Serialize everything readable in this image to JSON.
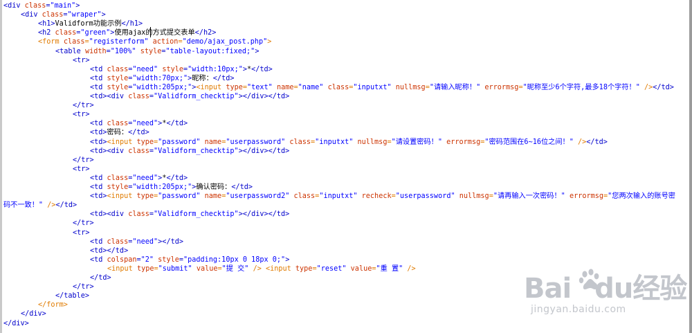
{
  "code_lines": [
    {
      "indent": 0,
      "tokens": [
        {
          "c": "tag",
          "t": "<div "
        },
        {
          "c": "at",
          "t": "class"
        },
        {
          "c": "tag",
          "t": "="
        },
        {
          "c": "val",
          "t": "\"main\""
        },
        {
          "c": "tag",
          "t": ">"
        }
      ]
    },
    {
      "indent": 1,
      "tokens": [
        {
          "c": "tag",
          "t": "<div "
        },
        {
          "c": "at",
          "t": "class"
        },
        {
          "c": "tag",
          "t": "="
        },
        {
          "c": "val",
          "t": "\"wraper\""
        },
        {
          "c": "tag",
          "t": ">"
        }
      ]
    },
    {
      "indent": 2,
      "tokens": [
        {
          "c": "tag",
          "t": "<h1>"
        },
        {
          "c": "txt",
          "t": "Validform功能示例"
        },
        {
          "c": "tag",
          "t": "</h1>"
        }
      ]
    },
    {
      "indent": 2,
      "tokens": [
        {
          "c": "tag",
          "t": "<h2 "
        },
        {
          "c": "at",
          "t": "class"
        },
        {
          "c": "tag",
          "t": "="
        },
        {
          "c": "val",
          "t": "\"green\""
        },
        {
          "c": "tag",
          "t": ">"
        },
        {
          "c": "txt",
          "t": "使用ajax的方式提交表单"
        },
        {
          "c": "tag",
          "t": "</h2>"
        }
      ]
    },
    {
      "indent": 2,
      "tokens": [
        {
          "c": "form",
          "t": "<form "
        },
        {
          "c": "at",
          "t": "class"
        },
        {
          "c": "form",
          "t": "="
        },
        {
          "c": "val",
          "t": "\"registerform\""
        },
        {
          "c": "form",
          "t": " "
        },
        {
          "c": "at",
          "t": "action"
        },
        {
          "c": "form",
          "t": "="
        },
        {
          "c": "val",
          "t": "\"demo/ajax_post.php\""
        },
        {
          "c": "form",
          "t": ">"
        }
      ]
    },
    {
      "indent": 3,
      "tokens": [
        {
          "c": "tag",
          "t": "<table "
        },
        {
          "c": "at",
          "t": "width"
        },
        {
          "c": "tag",
          "t": "="
        },
        {
          "c": "val",
          "t": "\"100%\""
        },
        {
          "c": "tag",
          "t": " "
        },
        {
          "c": "at",
          "t": "style"
        },
        {
          "c": "tag",
          "t": "="
        },
        {
          "c": "val",
          "t": "\"table-layout:fixed;\""
        },
        {
          "c": "tag",
          "t": ">"
        }
      ]
    },
    {
      "indent": 4,
      "tokens": [
        {
          "c": "tag",
          "t": "<tr>"
        }
      ]
    },
    {
      "indent": 5,
      "tokens": [
        {
          "c": "tag",
          "t": "<td "
        },
        {
          "c": "at",
          "t": "class"
        },
        {
          "c": "tag",
          "t": "="
        },
        {
          "c": "val",
          "t": "\"need\""
        },
        {
          "c": "tag",
          "t": " "
        },
        {
          "c": "at",
          "t": "style"
        },
        {
          "c": "tag",
          "t": "="
        },
        {
          "c": "val",
          "t": "\"width:10px;\""
        },
        {
          "c": "tag",
          "t": ">"
        },
        {
          "c": "txt",
          "t": "*"
        },
        {
          "c": "tag",
          "t": "</td>"
        }
      ]
    },
    {
      "indent": 5,
      "tokens": [
        {
          "c": "tag",
          "t": "<td "
        },
        {
          "c": "at",
          "t": "style"
        },
        {
          "c": "tag",
          "t": "="
        },
        {
          "c": "val",
          "t": "\"width:70px;\""
        },
        {
          "c": "tag",
          "t": ">"
        },
        {
          "c": "txt",
          "t": "昵称："
        },
        {
          "c": "tag",
          "t": "</td>"
        }
      ]
    },
    {
      "indent": 5,
      "tokens": [
        {
          "c": "tag",
          "t": "<td "
        },
        {
          "c": "at",
          "t": "style"
        },
        {
          "c": "tag",
          "t": "="
        },
        {
          "c": "val",
          "t": "\"width:205px;\""
        },
        {
          "c": "tag",
          "t": ">"
        },
        {
          "c": "form",
          "t": "<input "
        },
        {
          "c": "at",
          "t": "type"
        },
        {
          "c": "form",
          "t": "="
        },
        {
          "c": "val",
          "t": "\"text\""
        },
        {
          "c": "form",
          "t": " "
        },
        {
          "c": "at",
          "t": "name"
        },
        {
          "c": "form",
          "t": "="
        },
        {
          "c": "val",
          "t": "\"name\""
        },
        {
          "c": "form",
          "t": " "
        },
        {
          "c": "at",
          "t": "class"
        },
        {
          "c": "form",
          "t": "="
        },
        {
          "c": "val",
          "t": "\"inputxt\""
        },
        {
          "c": "form",
          "t": " "
        },
        {
          "c": "at",
          "t": "nullmsg"
        },
        {
          "c": "form",
          "t": "="
        },
        {
          "c": "val",
          "t": "\"请输入昵称！\""
        },
        {
          "c": "form",
          "t": " "
        },
        {
          "c": "at",
          "t": "errormsg"
        },
        {
          "c": "form",
          "t": "="
        },
        {
          "c": "val",
          "t": "\"昵称至少6个字符,最多18个字符！\""
        },
        {
          "c": "form",
          "t": " />"
        },
        {
          "c": "tag",
          "t": "</td>"
        }
      ]
    },
    {
      "indent": 5,
      "tokens": [
        {
          "c": "tag",
          "t": "<td><div "
        },
        {
          "c": "at",
          "t": "class"
        },
        {
          "c": "tag",
          "t": "="
        },
        {
          "c": "val",
          "t": "\"Validform_checktip\""
        },
        {
          "c": "tag",
          "t": "></div></td>"
        }
      ]
    },
    {
      "indent": 4,
      "tokens": [
        {
          "c": "tag",
          "t": "</tr>"
        }
      ]
    },
    {
      "indent": 4,
      "tokens": [
        {
          "c": "tag",
          "t": "<tr>"
        }
      ]
    },
    {
      "indent": 5,
      "tokens": [
        {
          "c": "tag",
          "t": "<td "
        },
        {
          "c": "at",
          "t": "class"
        },
        {
          "c": "tag",
          "t": "="
        },
        {
          "c": "val",
          "t": "\"need\""
        },
        {
          "c": "tag",
          "t": ">"
        },
        {
          "c": "txt",
          "t": "*"
        },
        {
          "c": "tag",
          "t": "</td>"
        }
      ]
    },
    {
      "indent": 5,
      "tokens": [
        {
          "c": "tag",
          "t": "<td>"
        },
        {
          "c": "txt",
          "t": "密码："
        },
        {
          "c": "tag",
          "t": "</td>"
        }
      ]
    },
    {
      "indent": 5,
      "tokens": [
        {
          "c": "tag",
          "t": "<td>"
        },
        {
          "c": "form",
          "t": "<input "
        },
        {
          "c": "at",
          "t": "type"
        },
        {
          "c": "form",
          "t": "="
        },
        {
          "c": "val",
          "t": "\"password\""
        },
        {
          "c": "form",
          "t": " "
        },
        {
          "c": "at",
          "t": "name"
        },
        {
          "c": "form",
          "t": "="
        },
        {
          "c": "val",
          "t": "\"userpassword\""
        },
        {
          "c": "form",
          "t": " "
        },
        {
          "c": "at",
          "t": "class"
        },
        {
          "c": "form",
          "t": "="
        },
        {
          "c": "val",
          "t": "\"inputxt\""
        },
        {
          "c": "form",
          "t": " "
        },
        {
          "c": "at",
          "t": "nullmsg"
        },
        {
          "c": "form",
          "t": "="
        },
        {
          "c": "val",
          "t": "\"请设置密码！\""
        },
        {
          "c": "form",
          "t": " "
        },
        {
          "c": "at",
          "t": "errormsg"
        },
        {
          "c": "form",
          "t": "="
        },
        {
          "c": "val",
          "t": "\"密码范围在6~16位之间！\""
        },
        {
          "c": "form",
          "t": " />"
        },
        {
          "c": "tag",
          "t": "</td>"
        }
      ]
    },
    {
      "indent": 5,
      "tokens": [
        {
          "c": "tag",
          "t": "<td><div "
        },
        {
          "c": "at",
          "t": "class"
        },
        {
          "c": "tag",
          "t": "="
        },
        {
          "c": "val",
          "t": "\"Validform_checktip\""
        },
        {
          "c": "tag",
          "t": "></div></td>"
        }
      ]
    },
    {
      "indent": 4,
      "tokens": [
        {
          "c": "tag",
          "t": "</tr>"
        }
      ]
    },
    {
      "indent": 4,
      "tokens": [
        {
          "c": "tag",
          "t": "<tr>"
        }
      ]
    },
    {
      "indent": 5,
      "tokens": [
        {
          "c": "tag",
          "t": "<td "
        },
        {
          "c": "at",
          "t": "class"
        },
        {
          "c": "tag",
          "t": "="
        },
        {
          "c": "val",
          "t": "\"need\""
        },
        {
          "c": "tag",
          "t": ">"
        },
        {
          "c": "txt",
          "t": "*"
        },
        {
          "c": "tag",
          "t": "</td>"
        }
      ]
    },
    {
      "indent": 5,
      "tokens": [
        {
          "c": "tag",
          "t": "<td "
        },
        {
          "c": "at",
          "t": "style"
        },
        {
          "c": "tag",
          "t": "="
        },
        {
          "c": "val",
          "t": "\"width:205px;\""
        },
        {
          "c": "tag",
          "t": ">"
        },
        {
          "c": "txt",
          "t": "确认密码："
        },
        {
          "c": "tag",
          "t": "</td>"
        }
      ]
    },
    {
      "indent": 5,
      "tokens": [
        {
          "c": "tag",
          "t": "<td>"
        },
        {
          "c": "form",
          "t": "<input "
        },
        {
          "c": "at",
          "t": "type"
        },
        {
          "c": "form",
          "t": "="
        },
        {
          "c": "val",
          "t": "\"password\""
        },
        {
          "c": "form",
          "t": " "
        },
        {
          "c": "at",
          "t": "name"
        },
        {
          "c": "form",
          "t": "="
        },
        {
          "c": "val",
          "t": "\"userpassword2\""
        },
        {
          "c": "form",
          "t": " "
        },
        {
          "c": "at",
          "t": "class"
        },
        {
          "c": "form",
          "t": "="
        },
        {
          "c": "val",
          "t": "\"inputxt\""
        },
        {
          "c": "form",
          "t": " "
        },
        {
          "c": "at",
          "t": "recheck"
        },
        {
          "c": "form",
          "t": "="
        },
        {
          "c": "val",
          "t": "\"userpassword\""
        },
        {
          "c": "form",
          "t": " "
        },
        {
          "c": "at",
          "t": "nullmsg"
        },
        {
          "c": "form",
          "t": "="
        },
        {
          "c": "val",
          "t": "\"请再输入一次密码！\""
        },
        {
          "c": "form",
          "t": " "
        },
        {
          "c": "at",
          "t": "errormsg"
        },
        {
          "c": "form",
          "t": "="
        },
        {
          "c": "val",
          "t": "\"您两次输入的账号密"
        }
      ]
    },
    {
      "indent": 0,
      "tokens": [
        {
          "c": "val",
          "t": "码不一致！\""
        },
        {
          "c": "form",
          "t": " />"
        },
        {
          "c": "tag",
          "t": "</td>"
        }
      ]
    },
    {
      "indent": 5,
      "tokens": [
        {
          "c": "tag",
          "t": "<td><div "
        },
        {
          "c": "at",
          "t": "class"
        },
        {
          "c": "tag",
          "t": "="
        },
        {
          "c": "val",
          "t": "\"Validform_checktip\""
        },
        {
          "c": "tag",
          "t": "></div></td>"
        }
      ]
    },
    {
      "indent": 4,
      "tokens": [
        {
          "c": "tag",
          "t": "</tr>"
        }
      ]
    },
    {
      "indent": 4,
      "tokens": [
        {
          "c": "tag",
          "t": "<tr>"
        }
      ]
    },
    {
      "indent": 5,
      "tokens": [
        {
          "c": "tag",
          "t": "<td "
        },
        {
          "c": "at",
          "t": "class"
        },
        {
          "c": "tag",
          "t": "="
        },
        {
          "c": "val",
          "t": "\"need\""
        },
        {
          "c": "tag",
          "t": "></td>"
        }
      ]
    },
    {
      "indent": 5,
      "tokens": [
        {
          "c": "tag",
          "t": "<td></td>"
        }
      ]
    },
    {
      "indent": 5,
      "tokens": [
        {
          "c": "tag",
          "t": "<td "
        },
        {
          "c": "at",
          "t": "colspan"
        },
        {
          "c": "tag",
          "t": "="
        },
        {
          "c": "val",
          "t": "\"2\""
        },
        {
          "c": "tag",
          "t": " "
        },
        {
          "c": "at",
          "t": "style"
        },
        {
          "c": "tag",
          "t": "="
        },
        {
          "c": "val",
          "t": "\"padding:10px 0 18px 0;\""
        },
        {
          "c": "tag",
          "t": ">"
        }
      ]
    },
    {
      "indent": 6,
      "tokens": [
        {
          "c": "form",
          "t": "<input "
        },
        {
          "c": "at",
          "t": "type"
        },
        {
          "c": "form",
          "t": "="
        },
        {
          "c": "val",
          "t": "\"submit\""
        },
        {
          "c": "form",
          "t": " "
        },
        {
          "c": "at",
          "t": "value"
        },
        {
          "c": "form",
          "t": "="
        },
        {
          "c": "val",
          "t": "\"提 交\""
        },
        {
          "c": "form",
          "t": " /> <input "
        },
        {
          "c": "at",
          "t": "type"
        },
        {
          "c": "form",
          "t": "="
        },
        {
          "c": "val",
          "t": "\"reset\""
        },
        {
          "c": "form",
          "t": " "
        },
        {
          "c": "at",
          "t": "value"
        },
        {
          "c": "form",
          "t": "="
        },
        {
          "c": "val",
          "t": "\"重 置\""
        },
        {
          "c": "form",
          "t": " />"
        }
      ]
    },
    {
      "indent": 5,
      "tokens": [
        {
          "c": "tag",
          "t": "</td>"
        }
      ]
    },
    {
      "indent": 4,
      "tokens": [
        {
          "c": "tag",
          "t": "</tr>"
        }
      ]
    },
    {
      "indent": 3,
      "tokens": [
        {
          "c": "tag",
          "t": "</table>"
        }
      ]
    },
    {
      "indent": 2,
      "tokens": [
        {
          "c": "form",
          "t": "</form>"
        }
      ]
    },
    {
      "indent": 1,
      "tokens": [
        {
          "c": "tag",
          "t": "</div>"
        }
      ]
    },
    {
      "indent": 0,
      "tokens": [
        {
          "c": "tag",
          "t": "</div>"
        }
      ]
    }
  ],
  "watermark": {
    "logo_text_1": "Bai",
    "logo_text_2": "du",
    "logo_text_3": "经验",
    "url": "jingyan.baidu.com",
    "icon": "baidu-paw-icon"
  },
  "colors": {
    "tag": "#0000cc",
    "attr": "#cc3300",
    "value": "#0000ff",
    "form_tag": "#e07b00",
    "text": "#000000",
    "watermark": "#c3c6cc"
  }
}
